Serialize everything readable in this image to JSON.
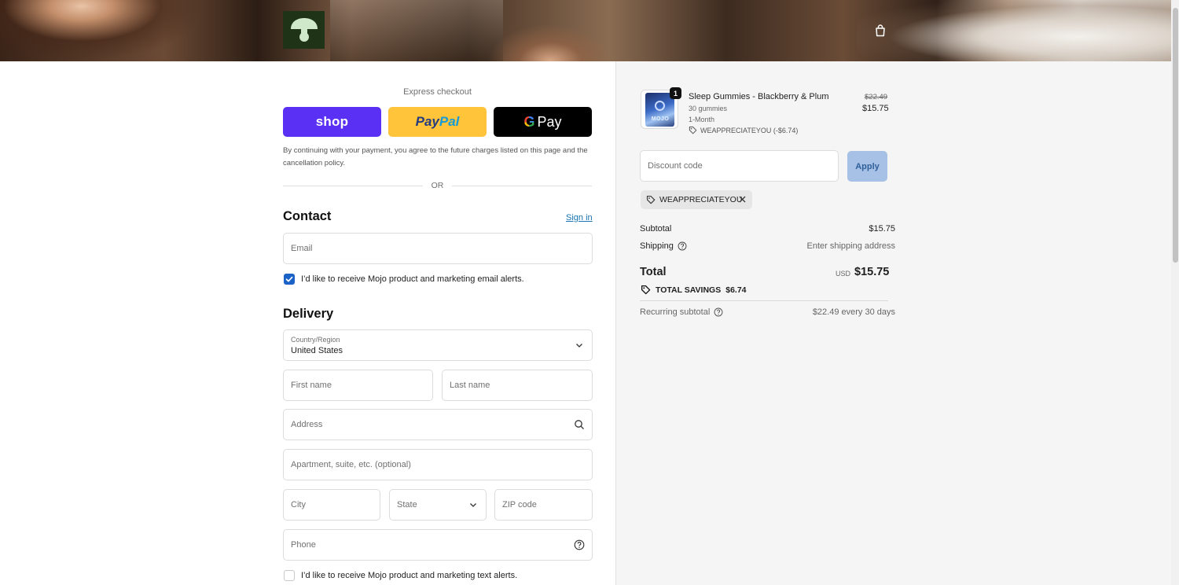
{
  "header": {
    "logo_alt": "mushroom-logo",
    "cart_icon": "shopping-bag-icon"
  },
  "express": {
    "title": "Express checkout",
    "shop_label": "shop",
    "paypal_label_a": "Pay",
    "paypal_label_b": "Pal",
    "gpay_g": "G",
    "gpay_label": "Pay",
    "consent": "By continuing with your payment, you agree to the future charges listed on this page and the cancellation policy.",
    "or": "OR"
  },
  "contact": {
    "heading": "Contact",
    "sign_in": "Sign in",
    "email_placeholder": "Email",
    "email_optin": "I’d like to receive Mojo product and marketing email alerts.",
    "email_optin_checked": true
  },
  "delivery": {
    "heading": "Delivery",
    "country_label": "Country/Region",
    "country_value": "United States",
    "first_name": "First name",
    "last_name": "Last name",
    "address": "Address",
    "apartment": "Apartment, suite, etc. (optional)",
    "city": "City",
    "state": "State",
    "zip": "ZIP code",
    "phone": "Phone",
    "sms_optin": "I’d like to receive Mojo product and marketing text alerts.",
    "sms_optin_checked": false
  },
  "summary": {
    "item": {
      "quantity": "1",
      "name": "Sleep Gummies - Blackberry & Plum",
      "count": "30 gummies",
      "plan": "1-Month",
      "discount_line": "WEAPPRECIATEYOU (-$6.74)",
      "original_price": "$22.49",
      "price": "$15.75",
      "thumb_text": "MOJO"
    },
    "discount_placeholder": "Discount code",
    "apply_label": "Apply",
    "applied_code": "WEAPPRECIATEYOU",
    "subtotal_label": "Subtotal",
    "subtotal_value": "$15.75",
    "shipping_label": "Shipping",
    "shipping_value": "Enter shipping address",
    "total_label": "Total",
    "currency": "USD",
    "total_value": "$15.75",
    "savings_label": "TOTAL SAVINGS",
    "savings_value": "$6.74",
    "recurring_label": "Recurring subtotal",
    "recurring_value": "$22.49 every 30 days"
  },
  "colors": {
    "shop": "#5a31f4",
    "paypal": "#ffc439",
    "gpay": "#000000",
    "link": "#1773b0",
    "checkbox": "#1a62c5",
    "apply_disabled": "#a6c1e5",
    "logo_bg": "#1f3317"
  }
}
